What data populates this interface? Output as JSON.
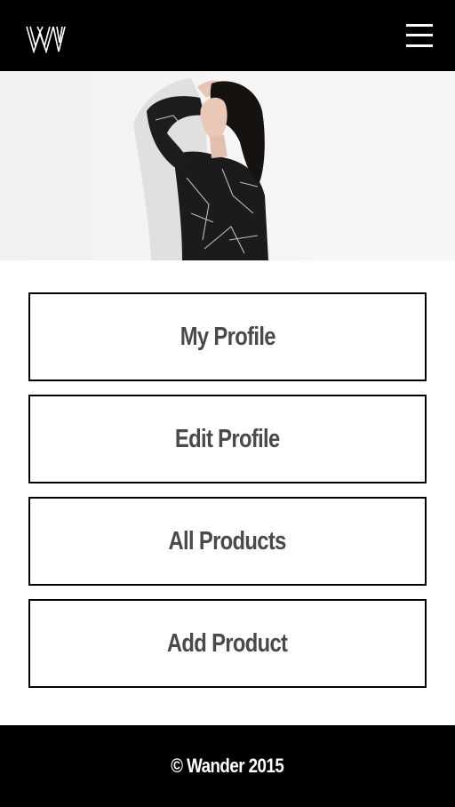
{
  "header": {
    "logo_icon": "wander-w-logo",
    "menu_icon": "hamburger-menu-icon"
  },
  "hero": {
    "image": "model-in-black-marble-print-shirt"
  },
  "nav": {
    "items": [
      {
        "label": "My Profile"
      },
      {
        "label": "Edit Profile"
      },
      {
        "label": "All Products"
      },
      {
        "label": "Add Product"
      }
    ]
  },
  "footer": {
    "copyright": "© Wander 2015"
  },
  "colors": {
    "header_bg": "#000000",
    "footer_bg": "#000000",
    "button_border": "#000000",
    "button_text": "#4a4a4a",
    "page_bg": "#ffffff"
  }
}
